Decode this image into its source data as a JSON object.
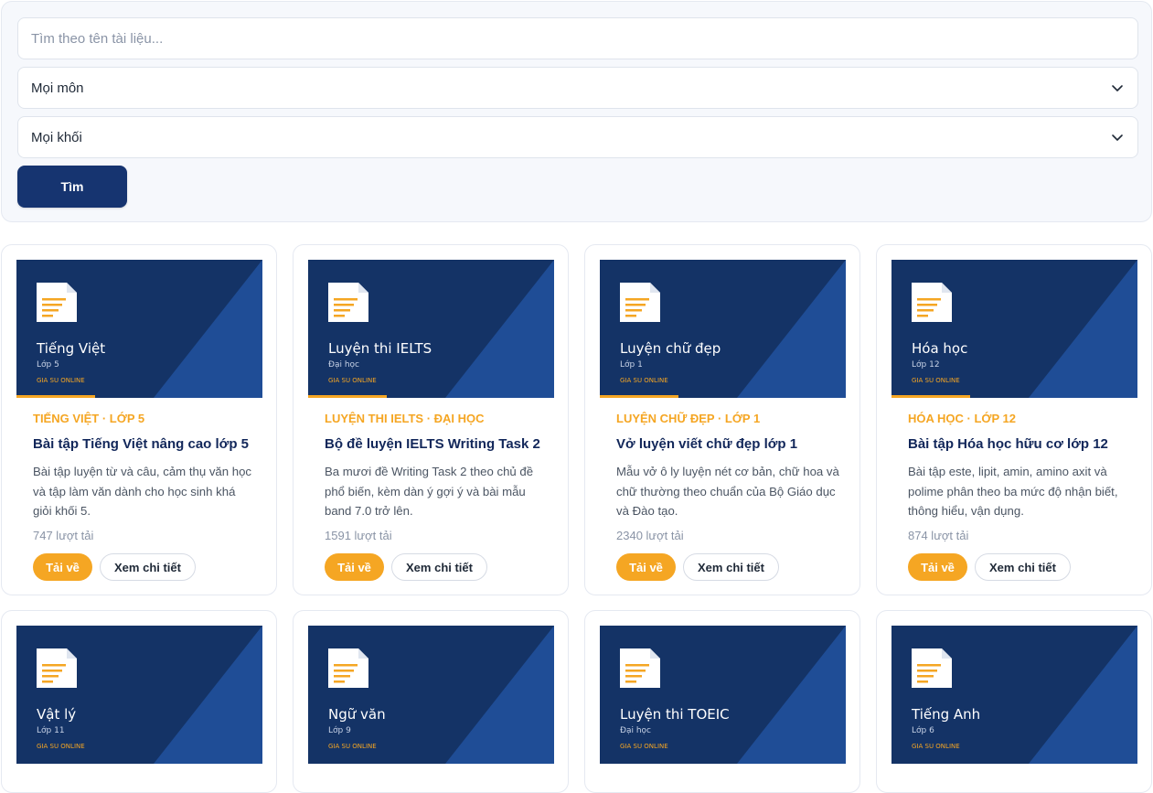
{
  "filters": {
    "search_placeholder": "Tìm theo tên tài liệu...",
    "subject_selected": "Mọi môn",
    "grade_selected": "Mọi khối",
    "search_button": "Tìm"
  },
  "thumb_brand": "GIA SU ONLINE",
  "colors": {
    "navy": "#143366",
    "navy_light": "#1f4d96",
    "accent": "#f5a623",
    "button": "#163470"
  },
  "cards": [
    {
      "subject": "Tiếng Việt",
      "grade": "Lớp 5",
      "tag": "TIẾNG VIỆT · LỚP 5",
      "title": "Bài tập Tiếng Việt nâng cao lớp 5",
      "desc": "Bài tập luyện từ và câu, cảm thụ văn học và tập làm văn dành cho học sinh khá giỏi khối 5.",
      "downloads": "747 lượt tải",
      "download_label": "Tải về",
      "detail_label": "Xem chi tiết"
    },
    {
      "subject": "Luyện thi IELTS",
      "grade": "Đại học",
      "tag": "LUYỆN THI IELTS · ĐẠI HỌC",
      "title": "Bộ đề luyện IELTS Writing Task 2",
      "desc": "Ba mươi đề Writing Task 2 theo chủ đề phổ biến, kèm dàn ý gợi ý và bài mẫu band 7.0 trở lên.",
      "downloads": "1591 lượt tải",
      "download_label": "Tải về",
      "detail_label": "Xem chi tiết"
    },
    {
      "subject": "Luyện chữ đẹp",
      "grade": "Lớp 1",
      "tag": "LUYỆN CHỮ ĐẸP · LỚP 1",
      "title": "Vở luyện viết chữ đẹp lớp 1",
      "desc": "Mẫu vở ô ly luyện nét cơ bản, chữ hoa và chữ thường theo chuẩn của Bộ Giáo dục và Đào tạo.",
      "downloads": "2340 lượt tải",
      "download_label": "Tải về",
      "detail_label": "Xem chi tiết"
    },
    {
      "subject": "Hóa học",
      "grade": "Lớp 12",
      "tag": "HÓA HỌC · LỚP 12",
      "title": "Bài tập Hóa học hữu cơ lớp 12",
      "desc": "Bài tập este, lipit, amin, amino axit và polime phân theo ba mức độ nhận biết, thông hiểu, vận dụng.",
      "downloads": "874 lượt tải",
      "download_label": "Tải về",
      "detail_label": "Xem chi tiết"
    },
    {
      "subject": "Vật lý",
      "grade": "Lớp 11"
    },
    {
      "subject": "Ngữ văn",
      "grade": "Lớp 9"
    },
    {
      "subject": "Luyện thi TOEIC",
      "grade": "Đại học"
    },
    {
      "subject": "Tiếng Anh",
      "grade": "Lớp 6"
    }
  ]
}
